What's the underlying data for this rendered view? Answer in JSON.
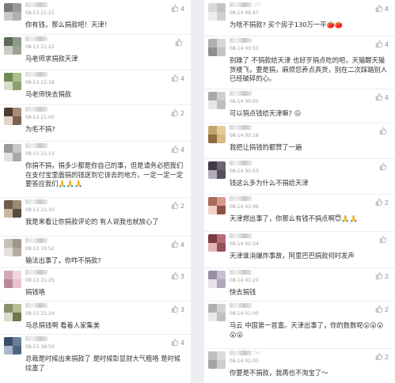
{
  "left": [
    {
      "avatar": [
        "#7a7a7a",
        "#9a9a9a",
        "#c9c9c9",
        "#b0b0b0"
      ],
      "name": "",
      "time": "08-13 21:21",
      "text": "你有钱，那么捐款吧！天津！",
      "likes": "4"
    },
    {
      "avatar": [
        "#5b6b54",
        "#8a9a84",
        "#c7ccc4",
        "#9aa296"
      ],
      "name": "",
      "time": "08-13 21:22",
      "text": "马老师求捐款天津",
      "likes": ""
    },
    {
      "avatar": [
        "#6f8a55",
        "#a8c08c",
        "#d6dfcb",
        "#8aa26f"
      ],
      "name": "",
      "time": "08-13 21:18",
      "text": "马老师快去捐款",
      "likes": "4"
    },
    {
      "avatar": [
        "#4f3b32",
        "#a88a76",
        "#e6d5c6",
        "#7d6253"
      ],
      "name": "",
      "time": "08-13 21:00",
      "text": "为毛不捐?",
      "likes": "2"
    },
    {
      "avatar": [
        "#9a9a9a",
        "#c8c8c8",
        "#e2e2e2",
        "#a9a9a9"
      ],
      "name": "",
      "time": "08-13 21:13",
      "text": "你捐不捐，捐多少都是你自己的事，但是请务必把我们在支付宝里面捐的钱送到它该去的地方，一定一定一定要答应我们🙏🙏🙏",
      "likes": "4"
    },
    {
      "avatar": [
        "#6e5c4b",
        "#9b8a74",
        "#c7b89f",
        "#5a4b3d"
      ],
      "name": "",
      "time": "08-13 21:10",
      "text": "我是来看让你捐款评论的 有人说我也就放心了",
      "likes": "2"
    },
    {
      "avatar": [
        "#c6c0b5",
        "#9c968d",
        "#e5e0d8",
        "#b3ada3"
      ],
      "name": "",
      "time": "08-13 19:52",
      "text": "输法出事了，你咋不捐款?",
      "likes": "4"
    },
    {
      "avatar": [
        "#d1a9b4",
        "#f0d6de",
        "#b88895",
        "#e7c2cd"
      ],
      "name": "",
      "time": "08-13 21:25",
      "text": "捐钱咯",
      "likes": "3"
    },
    {
      "avatar": [
        "#8a9168",
        "#b7bd97",
        "#d9dcc7",
        "#6f7650"
      ],
      "name": "",
      "time": "08-13 21:24",
      "text": "马总捐钱啊 看着人家集美",
      "likes": "3"
    },
    {
      "avatar": [
        "#3b4c66",
        "#6a7e9c",
        "#aab7c9",
        "#52657f"
      ],
      "name": "",
      "time": "08-13 18:50",
      "text": "总裁是时候出来捐款了 是时候彰显财大气粗咯 是时候炫富了",
      "likes": "4"
    }
  ],
  "right": [
    {
      "avatar": [
        "#d9d9d9",
        "#c2c2c2",
        "#ededed",
        "#d0d0d0"
      ],
      "name": "1030",
      "time": "08-14 09:47",
      "text": "为啥不捐款? 买个房子130万一平🍅🍅",
      "likes": "4"
    },
    {
      "avatar": [
        "#b0b0b0",
        "#d6d6d6",
        "#8f8f8f",
        "#c5c5c5"
      ],
      "name": "",
      "time": "08-14 00:55",
      "text": "别躁了 不捐款给天津 也好歹捐点吃的吧，天猫醒天猫货楼飞，要是捐，麻烦您养点真货，别在二次踩踏别人已经破碎的心。",
      "likes": "4"
    },
    {
      "avatar": [
        "#a9a9a9",
        "#cfcfcf",
        "#e6e6e6",
        "#bdbdbd"
      ],
      "name": "",
      "time": "08-14 00:05",
      "text": "可以捐点钱给天津嘛? 😖",
      "likes": "4"
    },
    {
      "avatar": [
        "#c7a46b",
        "#e4cc9c",
        "#8e6f3e",
        "#d9ba83"
      ],
      "name": "",
      "time": "08-14 00:18",
      "text": "我把让捐钱的都赞了一遍",
      "likes": ""
    },
    {
      "avatar": [
        "#3f3a46",
        "#6d6677",
        "#b4aebb",
        "#554f5e"
      ],
      "name": "",
      "time": "08-14 00:53",
      "text": "钱这么多为什么不捐给天津",
      "likes": ""
    },
    {
      "avatar": [
        "#a86b5c",
        "#d49a8a",
        "#f2d2c6",
        "#8c5246"
      ],
      "name": "",
      "time": "08-14 01:06",
      "text": "天津燃出事了，你那么有钱不捐点啊😇🙏🙏",
      "likes": "2"
    },
    {
      "avatar": [
        "#7b3a41",
        "#b86b73",
        "#e3b3b8",
        "#94505a"
      ],
      "name": "",
      "time": "08-14 00:34",
      "text": "天津谁消爆炸事故，阿里巴巴捐款何时发声",
      "likes": ""
    },
    {
      "avatar": [
        "#9a8fa6",
        "#c9bfd4",
        "#e7e1ec",
        "#b1a6bd"
      ],
      "name": "",
      "time": "08-14 01:20",
      "text": "快去捐钱",
      "likes": "2"
    },
    {
      "avatar": [
        "#b0b0b0",
        "#d3d3d3",
        "#e8e8e8",
        "#c0c0c0"
      ],
      "name": "",
      "time": "08-14 01:00",
      "text": "马云 中国第一首富。天津出事了，你的数数呢😮😮😮😮😮",
      "likes": "2"
    },
    {
      "avatar": [
        "#bfbfbf",
        "#dcdcdc",
        "#a5a5a5",
        "#cecece"
      ],
      "name": "Dec",
      "time": "08-14 02:00",
      "text": "你要是不捐款，我再也不淘宝了～",
      "likes": "2"
    }
  ]
}
